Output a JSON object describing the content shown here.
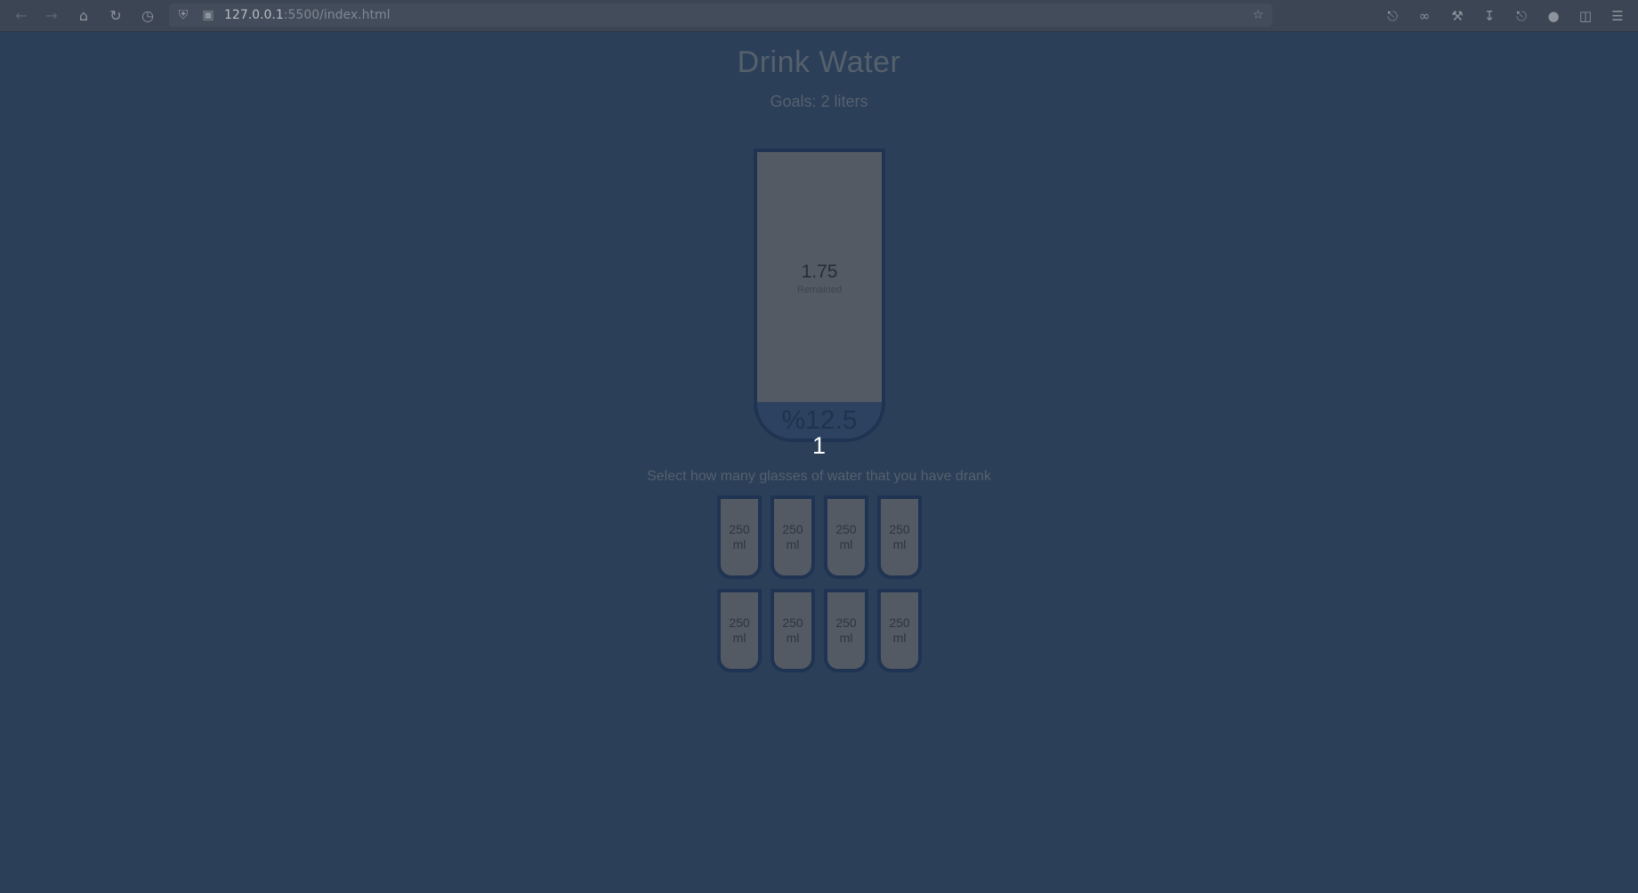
{
  "browser": {
    "url_host": "127.0.0.1",
    "url_rest": ":5500/index.html",
    "icons": {
      "back": "arrow-left-icon",
      "forward": "arrow-right-icon",
      "home": "home-icon",
      "reload": "reload-icon",
      "history": "clock-icon",
      "shield": "shield-icon",
      "page": "page-icon",
      "bookmark": "star-icon",
      "pocket": "save-icon",
      "extensions_mask": "mask-icon",
      "tools": "wrench-icon",
      "downloads": "download-icon",
      "passwords": "key-icon",
      "account": "account-icon",
      "addons": "puzzle-icon",
      "menu": "hamburger-icon"
    }
  },
  "header": {
    "title": "Drink Water",
    "goal": "Goals: 2 liters"
  },
  "big_cup": {
    "remained_liters": "1.75",
    "remained_label": "Remained",
    "percentage": "%12.5",
    "filled_fraction": 0.125
  },
  "glass_count": "1",
  "instruction": "Select how many glasses of water that you have drank",
  "cups": [
    {
      "amount": "250",
      "unit": "ml"
    },
    {
      "amount": "250",
      "unit": "ml"
    },
    {
      "amount": "250",
      "unit": "ml"
    },
    {
      "amount": "250",
      "unit": "ml"
    },
    {
      "amount": "250",
      "unit": "ml"
    },
    {
      "amount": "250",
      "unit": "ml"
    },
    {
      "amount": "250",
      "unit": "ml"
    },
    {
      "amount": "250",
      "unit": "ml"
    }
  ],
  "colors": {
    "background": "#2b3f58",
    "cup_fill": "#2d4260",
    "cup_border": "#1f3452",
    "cup_empty": "#545a64"
  }
}
